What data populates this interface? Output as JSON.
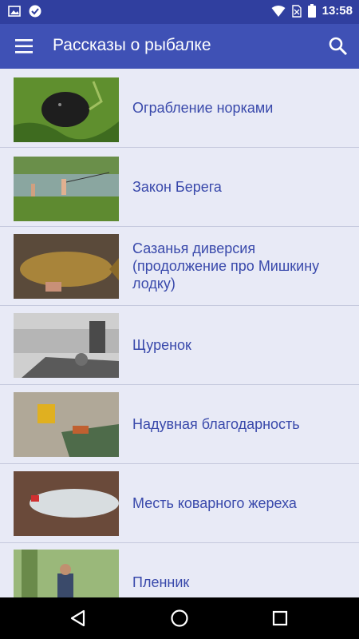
{
  "status_bar": {
    "time": "13:58",
    "icons": [
      "image-notification-icon",
      "check-notification-icon",
      "wifi-icon",
      "no-sim-icon",
      "battery-icon"
    ]
  },
  "app_bar": {
    "title": "Рассказы о рыбалке",
    "menu_icon": "hamburger-menu-icon",
    "search_icon": "search-icon"
  },
  "stories": [
    {
      "title": "Ограбление норками",
      "thumbnail": "mink-in-grass-photo"
    },
    {
      "title": "Закон Берега",
      "thumbnail": "kids-fishing-at-lake-photo"
    },
    {
      "title": "Сазанья диверсия (продолжение про Мишкину лодку)",
      "thumbnail": "carp-in-hands-photo"
    },
    {
      "title": "Щуренок",
      "thumbnail": "boy-in-boat-bw-photo"
    },
    {
      "title": "Надувная благодарность",
      "thumbnail": "inflatable-boat-photo"
    },
    {
      "title": "Месть коварного жереха",
      "thumbnail": "asp-fish-with-lure-photo"
    },
    {
      "title": "Пленник",
      "thumbnail": "angler-in-forest-photo"
    }
  ],
  "nav_bar": {
    "buttons": [
      "back-icon",
      "home-icon",
      "recents-icon"
    ]
  },
  "colors": {
    "primary": "#3f51b5",
    "primary_dark": "#303f9f",
    "background": "#e8eaf6",
    "text": "#3949ab"
  }
}
